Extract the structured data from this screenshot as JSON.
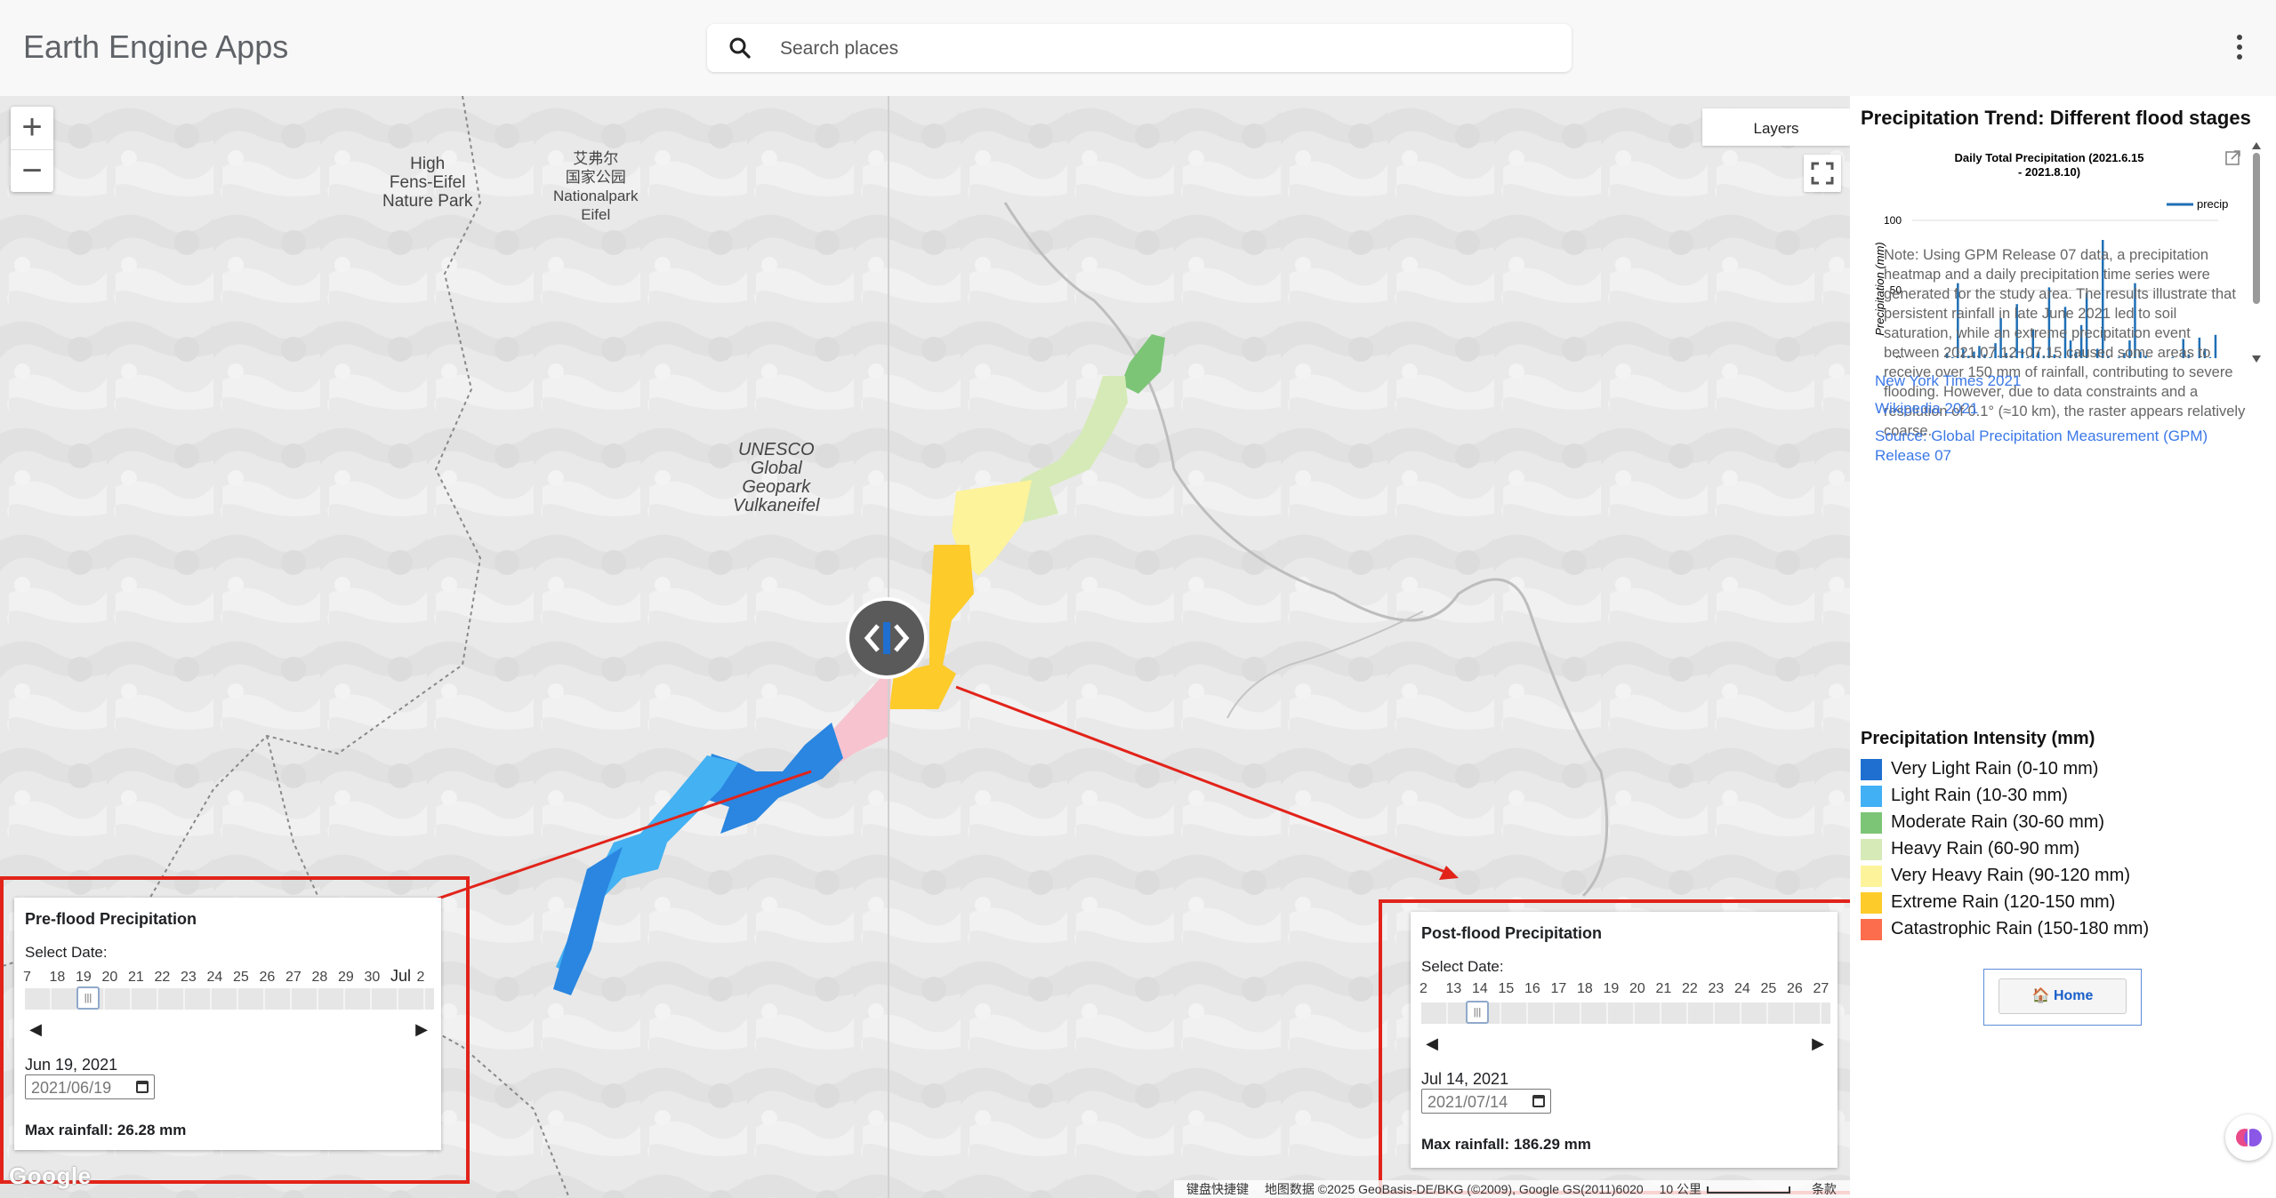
{
  "header": {
    "app_title": "Earth Engine Apps",
    "search_placeholder": "Search places"
  },
  "map": {
    "zoom_in": "+",
    "zoom_out": "−",
    "layers_label": "Layers",
    "labels": {
      "high_fens_eifel": "High\nFens-Eifel\nNature Park",
      "chinese_park": "艾弗尔\n国家公园\nNationalpark\nEifel",
      "unesco": "UNESCO\nGlobal\nGeopark\nVulkaneifel"
    },
    "google_logo": "Google",
    "attribution": {
      "shortcuts": "键盘快捷键",
      "data": "地图数据 ©2025 GeoBasis-DE/BKG (©2009), Google GS(2011)6020",
      "scale": "10 公里",
      "terms": "条款"
    }
  },
  "pre_flood": {
    "title": "Pre-flood Precipitation",
    "select_date_label": "Select Date:",
    "ticks": [
      "7",
      "18",
      "19",
      "20",
      "21",
      "22",
      "23",
      "24",
      "25",
      "26",
      "27",
      "28",
      "29",
      "30",
      "Jul",
      "2"
    ],
    "date_text": "Jun 19, 2021",
    "date_input_value": "2021/06/19",
    "max_rainfall": "Max rainfall: 26.28 mm"
  },
  "post_flood": {
    "title": "Post-flood Precipitation",
    "select_date_label": "Select Date:",
    "ticks": [
      "2",
      "13",
      "14",
      "15",
      "16",
      "17",
      "18",
      "19",
      "20",
      "21",
      "22",
      "23",
      "24",
      "25",
      "26",
      "27"
    ],
    "date_text": "Jul 14, 2021",
    "date_input_value": "2021/07/14",
    "max_rainfall": "Max rainfall: 186.29 mm"
  },
  "sidebar": {
    "title": "Precipitation Trend: Different flood stages",
    "note": "Note: Using GPM Release 07 data, a precipitation heatmap and a daily precipitation time series were generated for the study area. The results illustrate that persistent rainfall in late June 2021 led to soil saturation, while an extreme precipitation event between 2021.07.12~07.15 caused some areas to receive over 150 mm of rainfall, contributing to severe flooding. However, due to data constraints and a resolution of 0.1° (≈10 km), the raster appears relatively coarse.",
    "links": [
      "New York Times 2021",
      "Wikipedia 2021",
      "Source: Global Precipitation Measurement (GPM) Release 07"
    ],
    "legend_title": "Precipitation Intensity (mm)",
    "legend": [
      {
        "label": "Very Light Rain (0-10 mm)",
        "color": "#1f6fd0"
      },
      {
        "label": "Light Rain (10-30 mm)",
        "color": "#42b0f5"
      },
      {
        "label": "Moderate Rain (30-60 mm)",
        "color": "#7cc576"
      },
      {
        "label": "Heavy Rain (60-90 mm)",
        "color": "#d6eab8"
      },
      {
        "label": "Very Heavy Rain (90-120 mm)",
        "color": "#fdf39b"
      },
      {
        "label": "Extreme Rain (120-150 mm)",
        "color": "#fdcb2a"
      },
      {
        "label": "Catastrophic Rain (150-180 mm)",
        "color": "#fb6d4c"
      }
    ],
    "home_label": "🏠 Home"
  },
  "chart_data": {
    "type": "bar",
    "title": "Daily Total Precipitation (2021.6.15 - 2021.8.10)",
    "ylabel": "Precipitation (mm)",
    "xlabel": "",
    "ylim": [
      0,
      100
    ],
    "yticks": [
      0,
      50,
      100
    ],
    "legend": [
      "precip"
    ],
    "series": [
      {
        "name": "precip",
        "values": [
          0,
          0,
          0,
          0,
          0,
          0,
          5,
          2,
          55,
          8,
          3,
          6,
          10,
          4,
          2,
          12,
          30,
          5,
          3,
          40,
          8,
          2,
          22,
          6,
          3,
          52,
          4,
          2,
          38,
          14,
          6,
          25,
          48,
          0,
          8,
          86,
          3,
          0,
          2,
          5,
          14,
          55,
          6,
          3,
          0,
          0,
          0,
          0,
          2,
          0,
          15,
          4,
          0,
          16,
          8,
          2,
          18
        ]
      }
    ],
    "color": "#1f6fb5"
  }
}
